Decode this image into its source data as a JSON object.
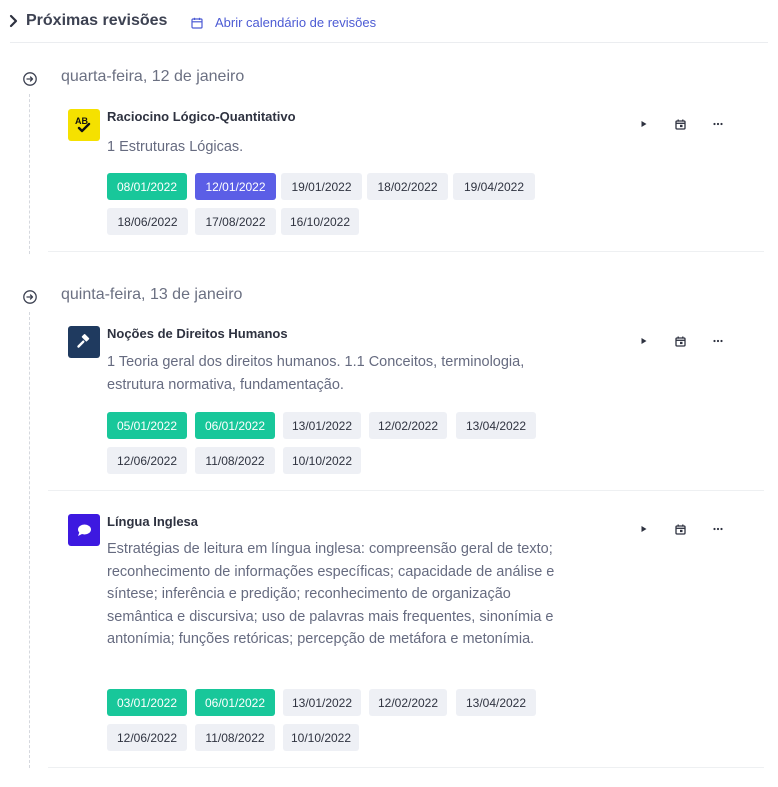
{
  "header": {
    "title": "Próximas revisões",
    "calendar_link": "Abrir calendário de revisões"
  },
  "days": [
    {
      "title": "quarta-feira, 12 de janeiro",
      "cards": [
        {
          "subject": "Raciocino Lógico-Quantitativo",
          "icon": "ab-check-icon",
          "icon_bg": "#f5e100",
          "description": "1 Estruturas Lógicas.",
          "dates": [
            {
              "label": "08/01/2022",
              "status": "done"
            },
            {
              "label": "12/01/2022",
              "status": "today"
            },
            {
              "label": "19/01/2022",
              "status": "pending"
            },
            {
              "label": "18/02/2022",
              "status": "pending"
            },
            {
              "label": "19/04/2022",
              "status": "pending"
            },
            {
              "label": "18/06/2022",
              "status": "pending"
            },
            {
              "label": "17/08/2022",
              "status": "pending"
            },
            {
              "label": "16/10/2022",
              "status": "pending"
            }
          ]
        }
      ]
    },
    {
      "title": "quinta-feira, 13 de janeiro",
      "cards": [
        {
          "subject": "Noções de Direitos Humanos",
          "icon": "gavel-icon",
          "icon_bg": "#1f3a5f",
          "description": "1 Teoria geral dos direitos humanos. 1.1 Conceitos, terminologia, estrutura normativa, fundamentação.",
          "dates": [
            {
              "label": "05/01/2022",
              "status": "done"
            },
            {
              "label": "06/01/2022",
              "status": "done"
            },
            {
              "label": "13/01/2022",
              "status": "pending"
            },
            {
              "label": "12/02/2022",
              "status": "pending"
            },
            {
              "label": "13/04/2022",
              "status": "pending"
            },
            {
              "label": "12/06/2022",
              "status": "pending"
            },
            {
              "label": "11/08/2022",
              "status": "pending"
            },
            {
              "label": "10/10/2022",
              "status": "pending"
            }
          ]
        },
        {
          "subject": "Língua Inglesa",
          "icon": "speech-bubble-icon",
          "icon_bg": "#3d19e0",
          "description": "Estratégias de leitura em língua inglesa: compreensão geral de texto; reconhecimento de informações específicas; capacidade de análise e síntese; inferência e predição; reconhecimento de organização semântica e discursiva; uso de palavras mais frequentes, sinonímia e antonímia; funções retóricas; percepção de metáfora e metonímia.",
          "dates": [
            {
              "label": "03/01/2022",
              "status": "done"
            },
            {
              "label": "06/01/2022",
              "status": "done"
            },
            {
              "label": "13/01/2022",
              "status": "pending"
            },
            {
              "label": "12/02/2022",
              "status": "pending"
            },
            {
              "label": "13/04/2022",
              "status": "pending"
            },
            {
              "label": "12/06/2022",
              "status": "pending"
            },
            {
              "label": "11/08/2022",
              "status": "pending"
            },
            {
              "label": "10/10/2022",
              "status": "pending"
            }
          ]
        }
      ]
    }
  ],
  "colors": {
    "done": "#18c79a",
    "today": "#5b5ee6",
    "pending": "#eef0f5",
    "link": "#4c5bd4"
  }
}
